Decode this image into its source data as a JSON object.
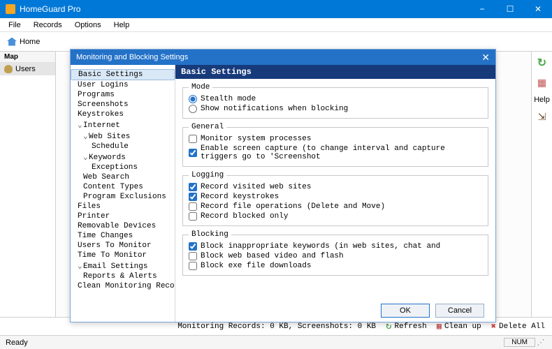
{
  "titlebar": {
    "app_name": "HomeGuard Pro"
  },
  "menu": {
    "file": "File",
    "records": "Records",
    "options": "Options",
    "help": "Help"
  },
  "toolbar": {
    "home": "Home"
  },
  "left_panel": {
    "map": "Map",
    "users": "Users"
  },
  "right_strip": {
    "help": "Help"
  },
  "dialog": {
    "title": "Monitoring and Blocking Settings",
    "section_header": "Basic Settings",
    "tree": {
      "basic": "Basic Settings",
      "user_logins": "User Logins",
      "programs": "Programs",
      "screenshots": "Screenshots",
      "keystrokes": "Keystrokes",
      "internet": "Internet",
      "web_sites": "Web Sites",
      "schedule": "Schedule",
      "keywords": "Keywords",
      "exceptions": "Exceptions",
      "web_search": "Web Search",
      "content_types": "Content Types",
      "program_exclusions": "Program Exclusions",
      "files": "Files",
      "printer": "Printer",
      "removable": "Removable Devices",
      "time_changes": "Time Changes",
      "users_to_monitor": "Users To Monitor",
      "time_to_monitor": "Time To Monitor",
      "email_settings": "Email Settings",
      "reports": "Reports & Alerts",
      "clean_records": "Clean Monitoring Records"
    },
    "mode": {
      "legend": "Mode",
      "stealth": "Stealth mode",
      "show_notif": "Show notifications when blocking"
    },
    "general": {
      "legend": "General",
      "monitor_sys": "Monitor system processes",
      "enable_capture": "Enable screen capture (to change  interval and capture triggers go to 'Screenshot"
    },
    "logging": {
      "legend": "Logging",
      "record_sites": "Record visited web sites",
      "record_keys": "Record keystrokes",
      "record_fileops": "Record file operations (Delete and Move)",
      "record_blocked": "Record blocked only"
    },
    "blocking": {
      "legend": "Blocking",
      "block_keywords": "Block inappropriate keywords (in web sites, chat and",
      "block_video": "Block web based video and flash",
      "block_exe": "Block exe file downloads"
    },
    "buttons": {
      "ok": "OK",
      "cancel": "Cancel"
    }
  },
  "bottom": {
    "status_text": "Monitoring Records: 0 KB, Screenshots: 0 KB",
    "refresh": "Refresh",
    "cleanup": "Clean up",
    "delete_all": "Delete All"
  },
  "status": {
    "ready": "Ready",
    "num": "NUM"
  }
}
